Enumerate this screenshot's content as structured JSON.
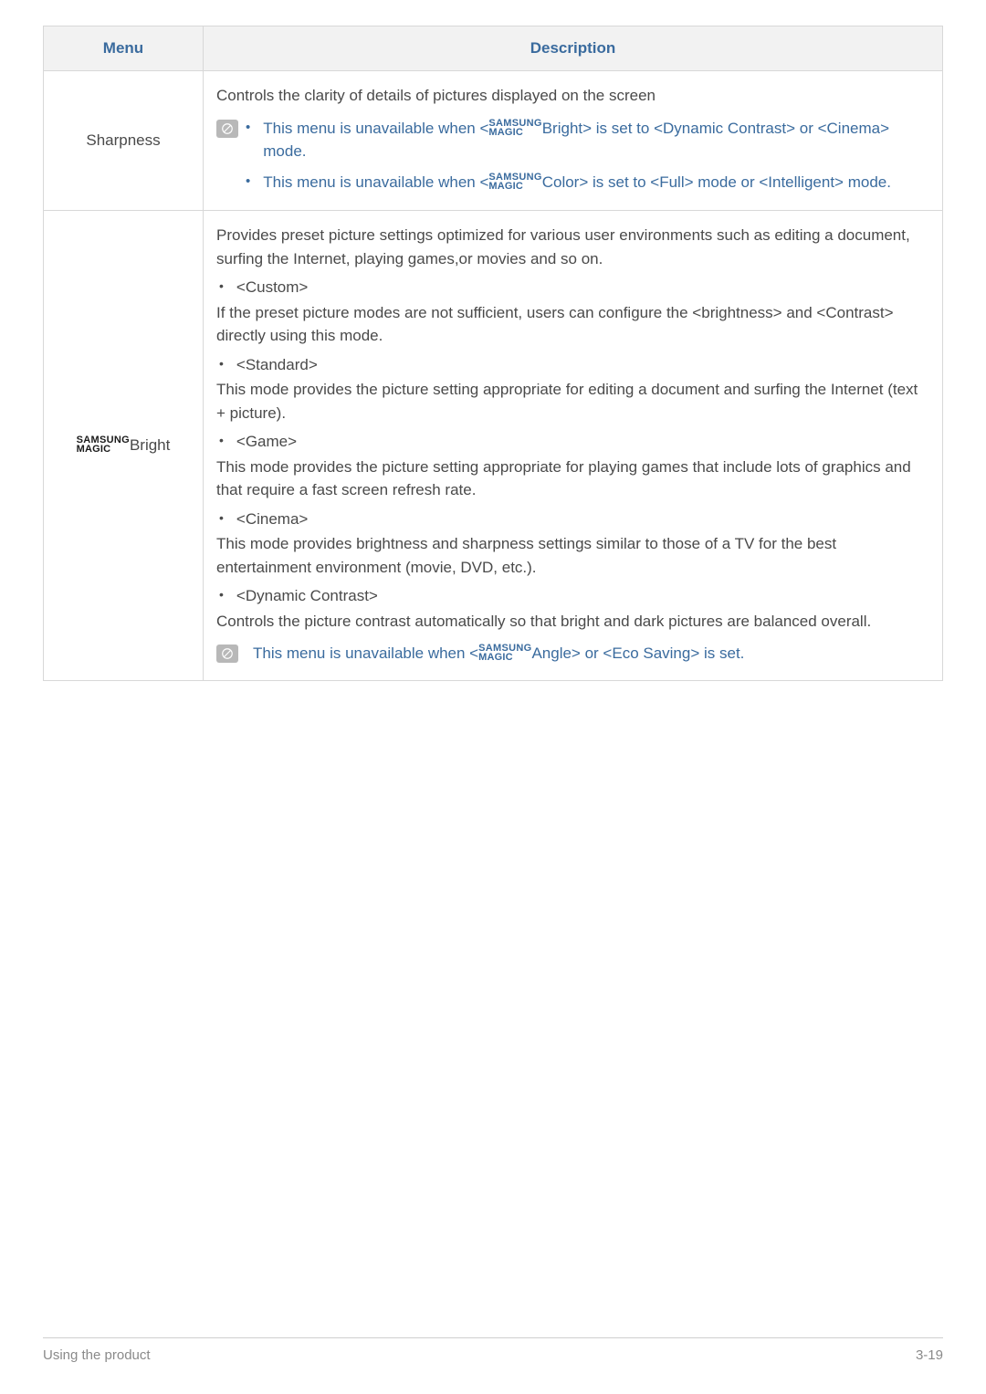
{
  "table": {
    "headers": {
      "menu": "Menu",
      "description": "Description"
    },
    "rows": {
      "sharpness": {
        "menu": "Sharpness",
        "intro": "Controls the clarity of details of pictures displayed on the screen",
        "notes": {
          "n1_pre": "This menu is unavailable when <",
          "n1_post": "Bright> is set to <Dynamic Contrast> or <Cinema> mode.",
          "n2_pre": "This menu is unavailable when <",
          "n2_post": "Color> is set to <Full> mode or <Intelligent> mode."
        }
      },
      "magicbright": {
        "menu_suffix": "Bright",
        "intro": "Provides preset picture settings optimized for various user environments such as editing a document, surfing the Internet, playing games,or movies and so on.",
        "opts": {
          "custom_label": "<Custom>",
          "custom_text": "If the preset picture modes are not sufficient, users can configure the <brightness> and <Contrast> directly using this mode.",
          "standard_label": "<Standard>",
          "standard_text": " This mode provides the picture setting appropriate for editing a document and surfing the Internet (text + picture).",
          "game_label": "<Game>",
          "game_text": "This mode provides the picture setting appropriate for playing games that include lots of graphics and that require a fast screen refresh rate.",
          "cinema_label": "<Cinema>",
          "cinema_text": "This mode provides brightness and sharpness settings similar to those of a TV for the best entertainment environment (movie, DVD, etc.).",
          "dynamic_label": "<Dynamic Contrast>",
          "dynamic_text": "Controls the picture contrast automatically so that bright and dark pictures are balanced overall."
        },
        "note_pre": "This menu is unavailable when <",
        "note_post": "Angle> or <Eco Saving> is set."
      }
    }
  },
  "magic_logo": {
    "top": "SAMSUNG",
    "bot": "MAGIC"
  },
  "footer": {
    "left": "Using the product",
    "right": "3-19"
  }
}
